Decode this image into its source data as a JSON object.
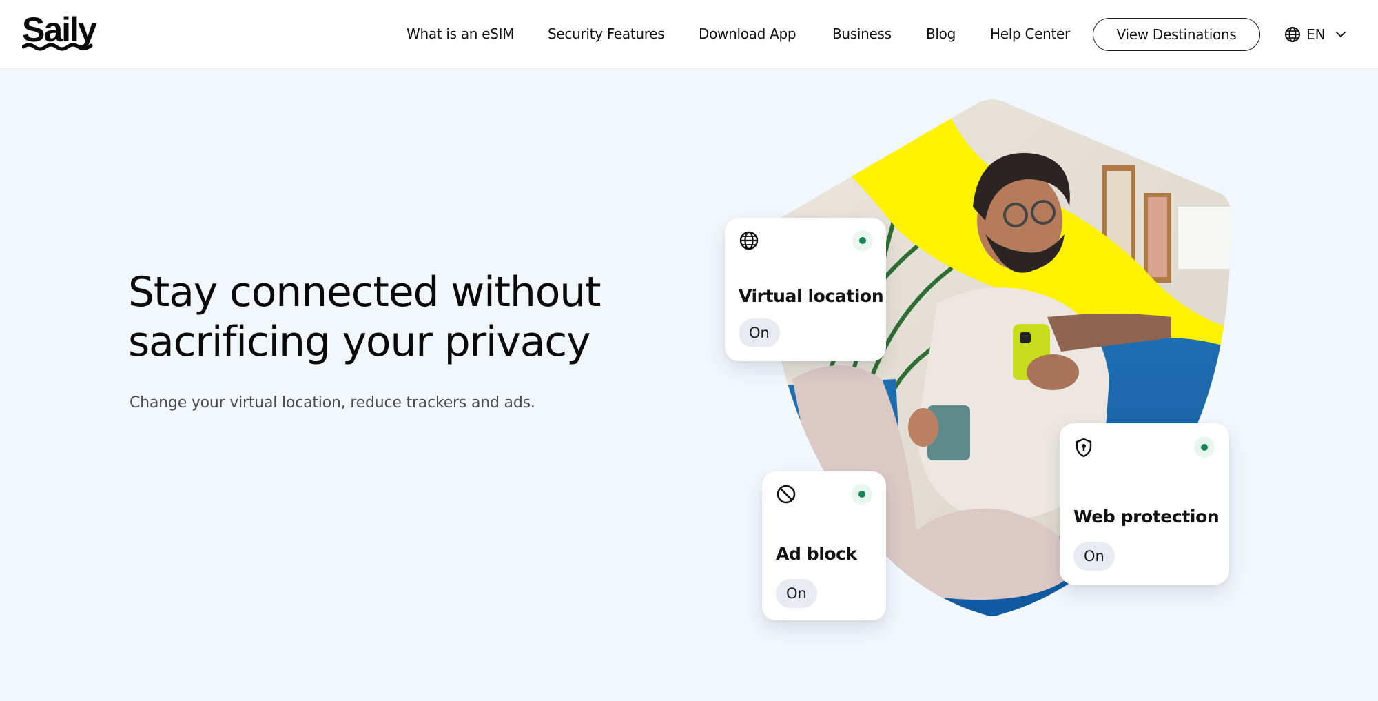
{
  "header": {
    "logo_text": "Saily",
    "nav": [
      {
        "label": "What is an eSIM"
      },
      {
        "label": "Security Features"
      },
      {
        "label": "Download App"
      },
      {
        "label": "Business"
      },
      {
        "label": "Blog"
      },
      {
        "label": "Help Center"
      }
    ],
    "cta_label": "View Destinations",
    "language": {
      "label": "EN",
      "icon": "globe-icon",
      "caret": "chevron-down-icon"
    }
  },
  "hero": {
    "title_lines": [
      "Stay connected without",
      "sacrificing your privacy"
    ],
    "subtitle": "Change your virtual location, reduce trackers and ads."
  },
  "features": [
    {
      "title": "Virtual location",
      "status": "On",
      "icon": "globe-icon",
      "active": true
    },
    {
      "title": "Ad block",
      "status": "On",
      "icon": "block-icon",
      "active": true
    },
    {
      "title": "Web protection",
      "status": "On",
      "icon": "shield-lock-icon",
      "active": true
    }
  ],
  "colors": {
    "background": "#f2f6fd",
    "accent_yellow": "#fff200",
    "status_green": "#16845a",
    "pill_bg": "#e7eaf0"
  }
}
